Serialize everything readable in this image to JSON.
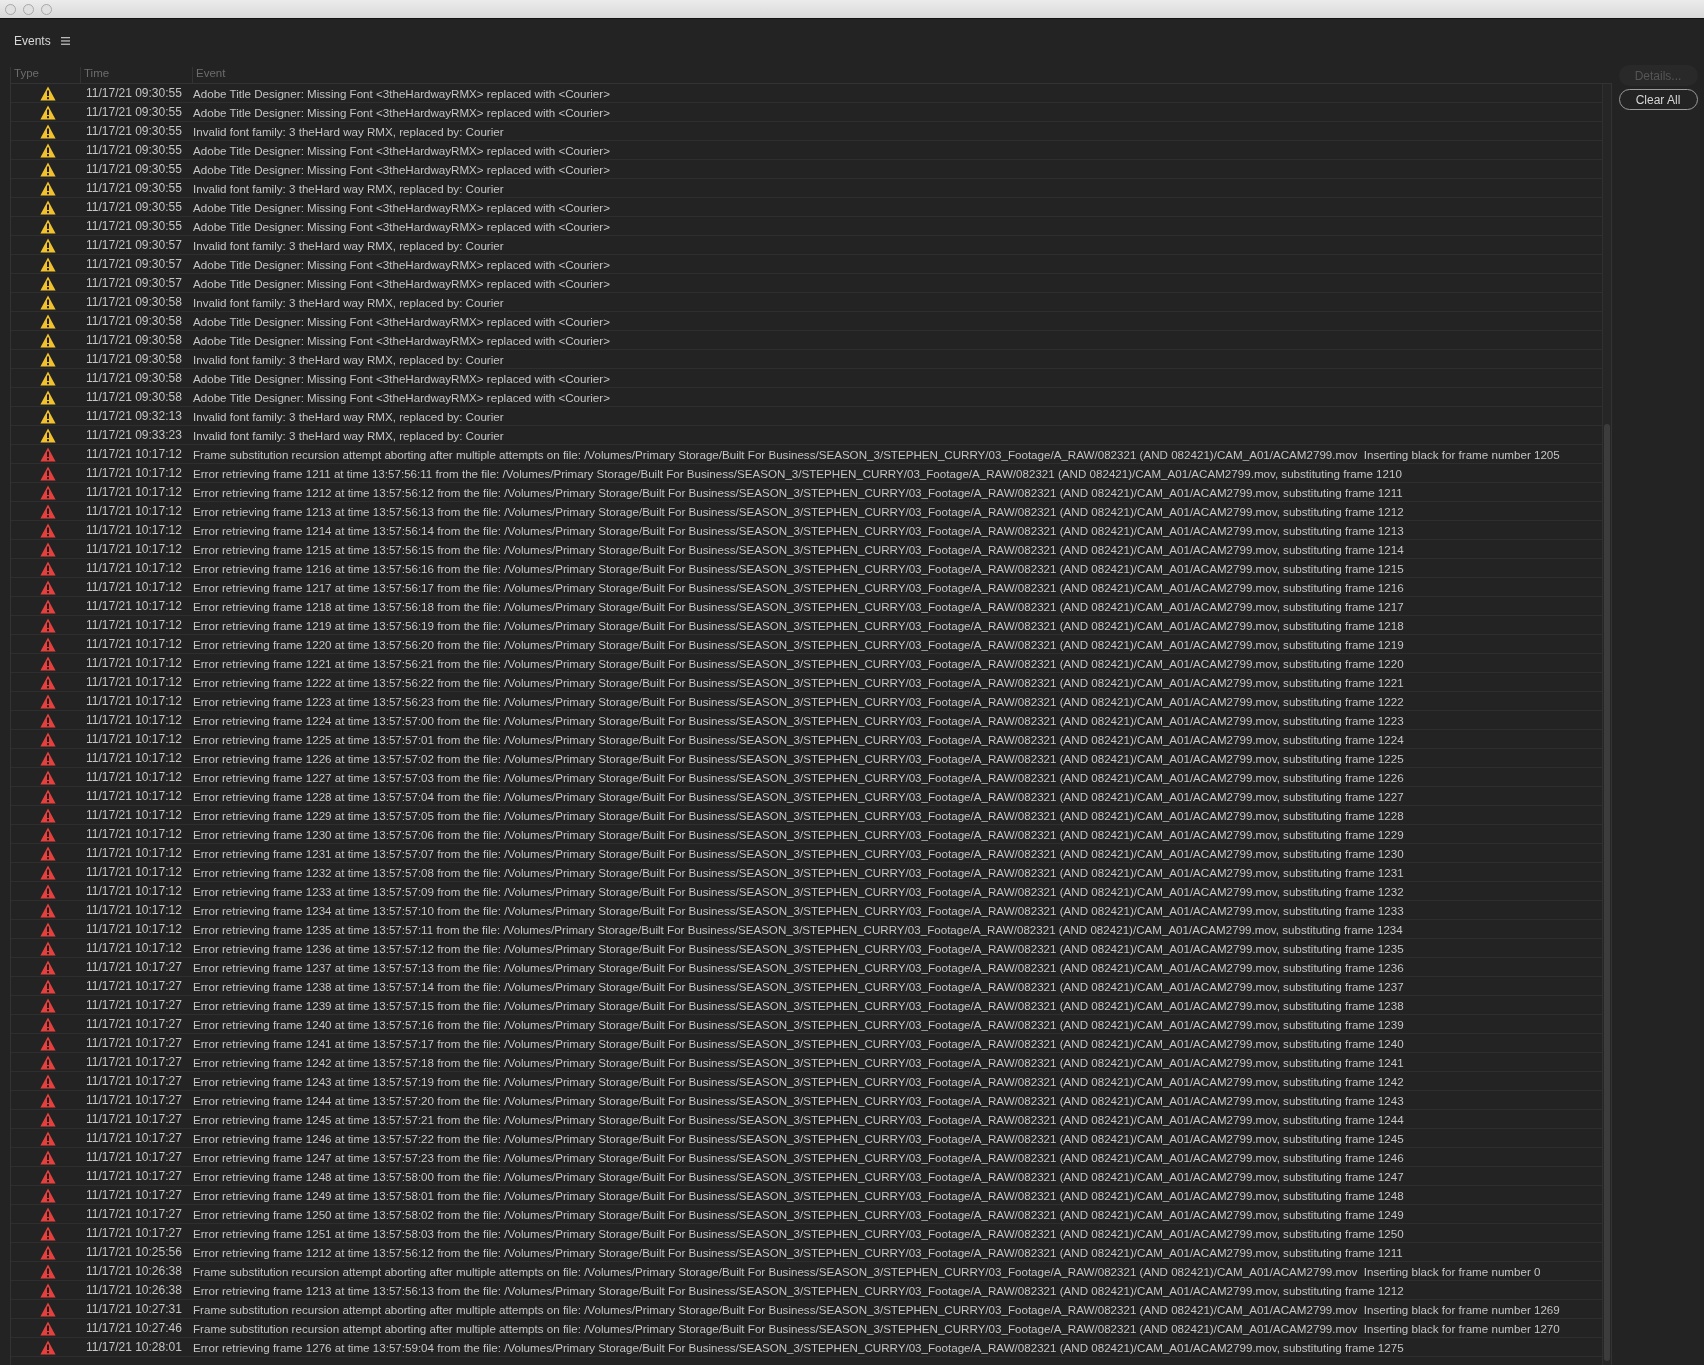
{
  "panel": {
    "title": "Events"
  },
  "table": {
    "columns": [
      "Type",
      "Time",
      "Event"
    ],
    "rows": [
      {
        "kind": "warning",
        "time": "11/17/21 09:30:55",
        "event": "Adobe Title Designer: Missing Font <3theHardwayRMX> replaced with <Courier>"
      },
      {
        "kind": "warning",
        "time": "11/17/21 09:30:55",
        "event": "Adobe Title Designer: Missing Font <3theHardwayRMX> replaced with <Courier>"
      },
      {
        "kind": "warning",
        "time": "11/17/21 09:30:55",
        "event": "Invalid font family: 3 theHard way RMX, replaced by: Courier"
      },
      {
        "kind": "warning",
        "time": "11/17/21 09:30:55",
        "event": "Adobe Title Designer: Missing Font <3theHardwayRMX> replaced with <Courier>"
      },
      {
        "kind": "warning",
        "time": "11/17/21 09:30:55",
        "event": "Adobe Title Designer: Missing Font <3theHardwayRMX> replaced with <Courier>"
      },
      {
        "kind": "warning",
        "time": "11/17/21 09:30:55",
        "event": "Invalid font family: 3 theHard way RMX, replaced by: Courier"
      },
      {
        "kind": "warning",
        "time": "11/17/21 09:30:55",
        "event": "Adobe Title Designer: Missing Font <3theHardwayRMX> replaced with <Courier>"
      },
      {
        "kind": "warning",
        "time": "11/17/21 09:30:55",
        "event": "Adobe Title Designer: Missing Font <3theHardwayRMX> replaced with <Courier>"
      },
      {
        "kind": "warning",
        "time": "11/17/21 09:30:57",
        "event": "Invalid font family: 3 theHard way RMX, replaced by: Courier"
      },
      {
        "kind": "warning",
        "time": "11/17/21 09:30:57",
        "event": "Adobe Title Designer: Missing Font <3theHardwayRMX> replaced with <Courier>"
      },
      {
        "kind": "warning",
        "time": "11/17/21 09:30:57",
        "event": "Adobe Title Designer: Missing Font <3theHardwayRMX> replaced with <Courier>"
      },
      {
        "kind": "warning",
        "time": "11/17/21 09:30:58",
        "event": "Invalid font family: 3 theHard way RMX, replaced by: Courier"
      },
      {
        "kind": "warning",
        "time": "11/17/21 09:30:58",
        "event": "Adobe Title Designer: Missing Font <3theHardwayRMX> replaced with <Courier>"
      },
      {
        "kind": "warning",
        "time": "11/17/21 09:30:58",
        "event": "Adobe Title Designer: Missing Font <3theHardwayRMX> replaced with <Courier>"
      },
      {
        "kind": "warning",
        "time": "11/17/21 09:30:58",
        "event": "Invalid font family: 3 theHard way RMX, replaced by: Courier"
      },
      {
        "kind": "warning",
        "time": "11/17/21 09:30:58",
        "event": "Adobe Title Designer: Missing Font <3theHardwayRMX> replaced with <Courier>"
      },
      {
        "kind": "warning",
        "time": "11/17/21 09:30:58",
        "event": "Adobe Title Designer: Missing Font <3theHardwayRMX> replaced with <Courier>"
      },
      {
        "kind": "warning",
        "time": "11/17/21 09:32:13",
        "event": "Invalid font family: 3 theHard way RMX, replaced by: Courier"
      },
      {
        "kind": "warning",
        "time": "11/17/21 09:33:23",
        "event": "Invalid font family: 3 theHard way RMX, replaced by: Courier"
      },
      {
        "kind": "error",
        "time": "11/17/21 10:17:12",
        "event": "Frame substitution recursion attempt aborting after multiple attempts on file: /Volumes/Primary Storage/Built For Business/SEASON_3/STEPHEN_CURRY/03_Footage/A_RAW/082321 (AND 082421)/CAM_A01/ACAM2799.mov  Inserting black for frame number 1205"
      },
      {
        "kind": "error",
        "time": "11/17/21 10:17:12",
        "event": "Error retrieving frame 1211 at time 13:57:56:11 from the file: /Volumes/Primary Storage/Built For Business/SEASON_3/STEPHEN_CURRY/03_Footage/A_RAW/082321 (AND 082421)/CAM_A01/ACAM2799.mov, substituting frame 1210"
      },
      {
        "kind": "error",
        "time": "11/17/21 10:17:12",
        "event": "Error retrieving frame 1212 at time 13:57:56:12 from the file: /Volumes/Primary Storage/Built For Business/SEASON_3/STEPHEN_CURRY/03_Footage/A_RAW/082321 (AND 082421)/CAM_A01/ACAM2799.mov, substituting frame 1211"
      },
      {
        "kind": "error",
        "time": "11/17/21 10:17:12",
        "event": "Error retrieving frame 1213 at time 13:57:56:13 from the file: /Volumes/Primary Storage/Built For Business/SEASON_3/STEPHEN_CURRY/03_Footage/A_RAW/082321 (AND 082421)/CAM_A01/ACAM2799.mov, substituting frame 1212"
      },
      {
        "kind": "error",
        "time": "11/17/21 10:17:12",
        "event": "Error retrieving frame 1214 at time 13:57:56:14 from the file: /Volumes/Primary Storage/Built For Business/SEASON_3/STEPHEN_CURRY/03_Footage/A_RAW/082321 (AND 082421)/CAM_A01/ACAM2799.mov, substituting frame 1213"
      },
      {
        "kind": "error",
        "time": "11/17/21 10:17:12",
        "event": "Error retrieving frame 1215 at time 13:57:56:15 from the file: /Volumes/Primary Storage/Built For Business/SEASON_3/STEPHEN_CURRY/03_Footage/A_RAW/082321 (AND 082421)/CAM_A01/ACAM2799.mov, substituting frame 1214"
      },
      {
        "kind": "error",
        "time": "11/17/21 10:17:12",
        "event": "Error retrieving frame 1216 at time 13:57:56:16 from the file: /Volumes/Primary Storage/Built For Business/SEASON_3/STEPHEN_CURRY/03_Footage/A_RAW/082321 (AND 082421)/CAM_A01/ACAM2799.mov, substituting frame 1215"
      },
      {
        "kind": "error",
        "time": "11/17/21 10:17:12",
        "event": "Error retrieving frame 1217 at time 13:57:56:17 from the file: /Volumes/Primary Storage/Built For Business/SEASON_3/STEPHEN_CURRY/03_Footage/A_RAW/082321 (AND 082421)/CAM_A01/ACAM2799.mov, substituting frame 1216"
      },
      {
        "kind": "error",
        "time": "11/17/21 10:17:12",
        "event": "Error retrieving frame 1218 at time 13:57:56:18 from the file: /Volumes/Primary Storage/Built For Business/SEASON_3/STEPHEN_CURRY/03_Footage/A_RAW/082321 (AND 082421)/CAM_A01/ACAM2799.mov, substituting frame 1217"
      },
      {
        "kind": "error",
        "time": "11/17/21 10:17:12",
        "event": "Error retrieving frame 1219 at time 13:57:56:19 from the file: /Volumes/Primary Storage/Built For Business/SEASON_3/STEPHEN_CURRY/03_Footage/A_RAW/082321 (AND 082421)/CAM_A01/ACAM2799.mov, substituting frame 1218"
      },
      {
        "kind": "error",
        "time": "11/17/21 10:17:12",
        "event": "Error retrieving frame 1220 at time 13:57:56:20 from the file: /Volumes/Primary Storage/Built For Business/SEASON_3/STEPHEN_CURRY/03_Footage/A_RAW/082321 (AND 082421)/CAM_A01/ACAM2799.mov, substituting frame 1219"
      },
      {
        "kind": "error",
        "time": "11/17/21 10:17:12",
        "event": "Error retrieving frame 1221 at time 13:57:56:21 from the file: /Volumes/Primary Storage/Built For Business/SEASON_3/STEPHEN_CURRY/03_Footage/A_RAW/082321 (AND 082421)/CAM_A01/ACAM2799.mov, substituting frame 1220"
      },
      {
        "kind": "error",
        "time": "11/17/21 10:17:12",
        "event": "Error retrieving frame 1222 at time 13:57:56:22 from the file: /Volumes/Primary Storage/Built For Business/SEASON_3/STEPHEN_CURRY/03_Footage/A_RAW/082321 (AND 082421)/CAM_A01/ACAM2799.mov, substituting frame 1221"
      },
      {
        "kind": "error",
        "time": "11/17/21 10:17:12",
        "event": "Error retrieving frame 1223 at time 13:57:56:23 from the file: /Volumes/Primary Storage/Built For Business/SEASON_3/STEPHEN_CURRY/03_Footage/A_RAW/082321 (AND 082421)/CAM_A01/ACAM2799.mov, substituting frame 1222"
      },
      {
        "kind": "error",
        "time": "11/17/21 10:17:12",
        "event": "Error retrieving frame 1224 at time 13:57:57:00 from the file: /Volumes/Primary Storage/Built For Business/SEASON_3/STEPHEN_CURRY/03_Footage/A_RAW/082321 (AND 082421)/CAM_A01/ACAM2799.mov, substituting frame 1223"
      },
      {
        "kind": "error",
        "time": "11/17/21 10:17:12",
        "event": "Error retrieving frame 1225 at time 13:57:57:01 from the file: /Volumes/Primary Storage/Built For Business/SEASON_3/STEPHEN_CURRY/03_Footage/A_RAW/082321 (AND 082421)/CAM_A01/ACAM2799.mov, substituting frame 1224"
      },
      {
        "kind": "error",
        "time": "11/17/21 10:17:12",
        "event": "Error retrieving frame 1226 at time 13:57:57:02 from the file: /Volumes/Primary Storage/Built For Business/SEASON_3/STEPHEN_CURRY/03_Footage/A_RAW/082321 (AND 082421)/CAM_A01/ACAM2799.mov, substituting frame 1225"
      },
      {
        "kind": "error",
        "time": "11/17/21 10:17:12",
        "event": "Error retrieving frame 1227 at time 13:57:57:03 from the file: /Volumes/Primary Storage/Built For Business/SEASON_3/STEPHEN_CURRY/03_Footage/A_RAW/082321 (AND 082421)/CAM_A01/ACAM2799.mov, substituting frame 1226"
      },
      {
        "kind": "error",
        "time": "11/17/21 10:17:12",
        "event": "Error retrieving frame 1228 at time 13:57:57:04 from the file: /Volumes/Primary Storage/Built For Business/SEASON_3/STEPHEN_CURRY/03_Footage/A_RAW/082321 (AND 082421)/CAM_A01/ACAM2799.mov, substituting frame 1227"
      },
      {
        "kind": "error",
        "time": "11/17/21 10:17:12",
        "event": "Error retrieving frame 1229 at time 13:57:57:05 from the file: /Volumes/Primary Storage/Built For Business/SEASON_3/STEPHEN_CURRY/03_Footage/A_RAW/082321 (AND 082421)/CAM_A01/ACAM2799.mov, substituting frame 1228"
      },
      {
        "kind": "error",
        "time": "11/17/21 10:17:12",
        "event": "Error retrieving frame 1230 at time 13:57:57:06 from the file: /Volumes/Primary Storage/Built For Business/SEASON_3/STEPHEN_CURRY/03_Footage/A_RAW/082321 (AND 082421)/CAM_A01/ACAM2799.mov, substituting frame 1229"
      },
      {
        "kind": "error",
        "time": "11/17/21 10:17:12",
        "event": "Error retrieving frame 1231 at time 13:57:57:07 from the file: /Volumes/Primary Storage/Built For Business/SEASON_3/STEPHEN_CURRY/03_Footage/A_RAW/082321 (AND 082421)/CAM_A01/ACAM2799.mov, substituting frame 1230"
      },
      {
        "kind": "error",
        "time": "11/17/21 10:17:12",
        "event": "Error retrieving frame 1232 at time 13:57:57:08 from the file: /Volumes/Primary Storage/Built For Business/SEASON_3/STEPHEN_CURRY/03_Footage/A_RAW/082321 (AND 082421)/CAM_A01/ACAM2799.mov, substituting frame 1231"
      },
      {
        "kind": "error",
        "time": "11/17/21 10:17:12",
        "event": "Error retrieving frame 1233 at time 13:57:57:09 from the file: /Volumes/Primary Storage/Built For Business/SEASON_3/STEPHEN_CURRY/03_Footage/A_RAW/082321 (AND 082421)/CAM_A01/ACAM2799.mov, substituting frame 1232"
      },
      {
        "kind": "error",
        "time": "11/17/21 10:17:12",
        "event": "Error retrieving frame 1234 at time 13:57:57:10 from the file: /Volumes/Primary Storage/Built For Business/SEASON_3/STEPHEN_CURRY/03_Footage/A_RAW/082321 (AND 082421)/CAM_A01/ACAM2799.mov, substituting frame 1233"
      },
      {
        "kind": "error",
        "time": "11/17/21 10:17:12",
        "event": "Error retrieving frame 1235 at time 13:57:57:11 from the file: /Volumes/Primary Storage/Built For Business/SEASON_3/STEPHEN_CURRY/03_Footage/A_RAW/082321 (AND 082421)/CAM_A01/ACAM2799.mov, substituting frame 1234"
      },
      {
        "kind": "error",
        "time": "11/17/21 10:17:12",
        "event": "Error retrieving frame 1236 at time 13:57:57:12 from the file: /Volumes/Primary Storage/Built For Business/SEASON_3/STEPHEN_CURRY/03_Footage/A_RAW/082321 (AND 082421)/CAM_A01/ACAM2799.mov, substituting frame 1235"
      },
      {
        "kind": "error",
        "time": "11/17/21 10:17:27",
        "event": "Error retrieving frame 1237 at time 13:57:57:13 from the file: /Volumes/Primary Storage/Built For Business/SEASON_3/STEPHEN_CURRY/03_Footage/A_RAW/082321 (AND 082421)/CAM_A01/ACAM2799.mov, substituting frame 1236"
      },
      {
        "kind": "error",
        "time": "11/17/21 10:17:27",
        "event": "Error retrieving frame 1238 at time 13:57:57:14 from the file: /Volumes/Primary Storage/Built For Business/SEASON_3/STEPHEN_CURRY/03_Footage/A_RAW/082321 (AND 082421)/CAM_A01/ACAM2799.mov, substituting frame 1237"
      },
      {
        "kind": "error",
        "time": "11/17/21 10:17:27",
        "event": "Error retrieving frame 1239 at time 13:57:57:15 from the file: /Volumes/Primary Storage/Built For Business/SEASON_3/STEPHEN_CURRY/03_Footage/A_RAW/082321 (AND 082421)/CAM_A01/ACAM2799.mov, substituting frame 1238"
      },
      {
        "kind": "error",
        "time": "11/17/21 10:17:27",
        "event": "Error retrieving frame 1240 at time 13:57:57:16 from the file: /Volumes/Primary Storage/Built For Business/SEASON_3/STEPHEN_CURRY/03_Footage/A_RAW/082321 (AND 082421)/CAM_A01/ACAM2799.mov, substituting frame 1239"
      },
      {
        "kind": "error",
        "time": "11/17/21 10:17:27",
        "event": "Error retrieving frame 1241 at time 13:57:57:17 from the file: /Volumes/Primary Storage/Built For Business/SEASON_3/STEPHEN_CURRY/03_Footage/A_RAW/082321 (AND 082421)/CAM_A01/ACAM2799.mov, substituting frame 1240"
      },
      {
        "kind": "error",
        "time": "11/17/21 10:17:27",
        "event": "Error retrieving frame 1242 at time 13:57:57:18 from the file: /Volumes/Primary Storage/Built For Business/SEASON_3/STEPHEN_CURRY/03_Footage/A_RAW/082321 (AND 082421)/CAM_A01/ACAM2799.mov, substituting frame 1241"
      },
      {
        "kind": "error",
        "time": "11/17/21 10:17:27",
        "event": "Error retrieving frame 1243 at time 13:57:57:19 from the file: /Volumes/Primary Storage/Built For Business/SEASON_3/STEPHEN_CURRY/03_Footage/A_RAW/082321 (AND 082421)/CAM_A01/ACAM2799.mov, substituting frame 1242"
      },
      {
        "kind": "error",
        "time": "11/17/21 10:17:27",
        "event": "Error retrieving frame 1244 at time 13:57:57:20 from the file: /Volumes/Primary Storage/Built For Business/SEASON_3/STEPHEN_CURRY/03_Footage/A_RAW/082321 (AND 082421)/CAM_A01/ACAM2799.mov, substituting frame 1243"
      },
      {
        "kind": "error",
        "time": "11/17/21 10:17:27",
        "event": "Error retrieving frame 1245 at time 13:57:57:21 from the file: /Volumes/Primary Storage/Built For Business/SEASON_3/STEPHEN_CURRY/03_Footage/A_RAW/082321 (AND 082421)/CAM_A01/ACAM2799.mov, substituting frame 1244"
      },
      {
        "kind": "error",
        "time": "11/17/21 10:17:27",
        "event": "Error retrieving frame 1246 at time 13:57:57:22 from the file: /Volumes/Primary Storage/Built For Business/SEASON_3/STEPHEN_CURRY/03_Footage/A_RAW/082321 (AND 082421)/CAM_A01/ACAM2799.mov, substituting frame 1245"
      },
      {
        "kind": "error",
        "time": "11/17/21 10:17:27",
        "event": "Error retrieving frame 1247 at time 13:57:57:23 from the file: /Volumes/Primary Storage/Built For Business/SEASON_3/STEPHEN_CURRY/03_Footage/A_RAW/082321 (AND 082421)/CAM_A01/ACAM2799.mov, substituting frame 1246"
      },
      {
        "kind": "error",
        "time": "11/17/21 10:17:27",
        "event": "Error retrieving frame 1248 at time 13:57:58:00 from the file: /Volumes/Primary Storage/Built For Business/SEASON_3/STEPHEN_CURRY/03_Footage/A_RAW/082321 (AND 082421)/CAM_A01/ACAM2799.mov, substituting frame 1247"
      },
      {
        "kind": "error",
        "time": "11/17/21 10:17:27",
        "event": "Error retrieving frame 1249 at time 13:57:58:01 from the file: /Volumes/Primary Storage/Built For Business/SEASON_3/STEPHEN_CURRY/03_Footage/A_RAW/082321 (AND 082421)/CAM_A01/ACAM2799.mov, substituting frame 1248"
      },
      {
        "kind": "error",
        "time": "11/17/21 10:17:27",
        "event": "Error retrieving frame 1250 at time 13:57:58:02 from the file: /Volumes/Primary Storage/Built For Business/SEASON_3/STEPHEN_CURRY/03_Footage/A_RAW/082321 (AND 082421)/CAM_A01/ACAM2799.mov, substituting frame 1249"
      },
      {
        "kind": "error",
        "time": "11/17/21 10:17:27",
        "event": "Error retrieving frame 1251 at time 13:57:58:03 from the file: /Volumes/Primary Storage/Built For Business/SEASON_3/STEPHEN_CURRY/03_Footage/A_RAW/082321 (AND 082421)/CAM_A01/ACAM2799.mov, substituting frame 1250"
      },
      {
        "kind": "error",
        "time": "11/17/21 10:25:56",
        "event": "Error retrieving frame 1212 at time 13:57:56:12 from the file: /Volumes/Primary Storage/Built For Business/SEASON_3/STEPHEN_CURRY/03_Footage/A_RAW/082321 (AND 082421)/CAM_A01/ACAM2799.mov, substituting frame 1211"
      },
      {
        "kind": "error",
        "time": "11/17/21 10:26:38",
        "event": "Frame substitution recursion attempt aborting after multiple attempts on file: /Volumes/Primary Storage/Built For Business/SEASON_3/STEPHEN_CURRY/03_Footage/A_RAW/082321 (AND 082421)/CAM_A01/ACAM2799.mov  Inserting black for frame number 0"
      },
      {
        "kind": "error",
        "time": "11/17/21 10:26:38",
        "event": "Error retrieving frame 1213 at time 13:57:56:13 from the file: /Volumes/Primary Storage/Built For Business/SEASON_3/STEPHEN_CURRY/03_Footage/A_RAW/082321 (AND 082421)/CAM_A01/ACAM2799.mov, substituting frame 1212"
      },
      {
        "kind": "error",
        "time": "11/17/21 10:27:31",
        "event": "Frame substitution recursion attempt aborting after multiple attempts on file: /Volumes/Primary Storage/Built For Business/SEASON_3/STEPHEN_CURRY/03_Footage/A_RAW/082321 (AND 082421)/CAM_A01/ACAM2799.mov  Inserting black for frame number 1269"
      },
      {
        "kind": "error",
        "time": "11/17/21 10:27:46",
        "event": "Frame substitution recursion attempt aborting after multiple attempts on file: /Volumes/Primary Storage/Built For Business/SEASON_3/STEPHEN_CURRY/03_Footage/A_RAW/082321 (AND 082421)/CAM_A01/ACAM2799.mov  Inserting black for frame number 1270"
      },
      {
        "kind": "error",
        "time": "11/17/21 10:28:01",
        "event": "Error retrieving frame 1276 at time 13:57:59:04 from the file: /Volumes/Primary Storage/Built For Business/SEASON_3/STEPHEN_CURRY/03_Footage/A_RAW/082321 (AND 082421)/CAM_A01/ACAM2799.mov, substituting frame 1275"
      }
    ]
  },
  "buttons": [
    {
      "label": "Details...",
      "disabled": true
    },
    {
      "label": "Clear All",
      "disabled": false
    }
  ]
}
